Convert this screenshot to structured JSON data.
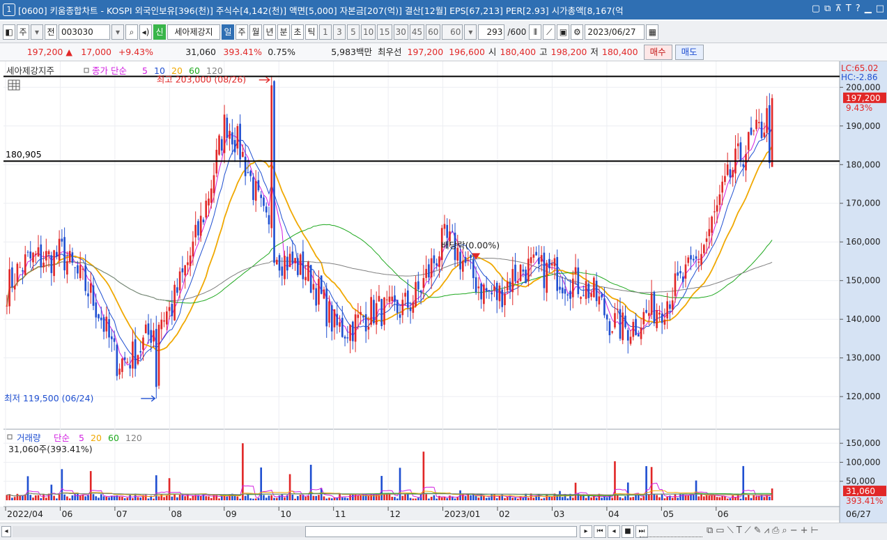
{
  "titlebar": {
    "index": "1",
    "title": "[0600] 키움종합차트 - KOSPI 외국인보유[396(천)] 주식수[4,142(천)] 액면[5,000] 자본금[207(억)] 결산[12월] EPS[67,213] PER[2.93] 시가총액[8,167(억"
  },
  "toolbar": {
    "period": "주",
    "jeon": "전",
    "code": "003030",
    "sin": "신",
    "stock_name": "세아제강지",
    "intervals": [
      "일",
      "주",
      "월",
      "년",
      "분",
      "초",
      "틱"
    ],
    "minutes": [
      "1",
      "3",
      "5",
      "10",
      "15",
      "30",
      "45",
      "60"
    ],
    "count_combo": "60",
    "count": "293",
    "count_max": "/600",
    "date": "2023/06/27"
  },
  "infobar": {
    "price": "197,200",
    "change": "17,000",
    "change_pct": "+9.43%",
    "volume": "31,060",
    "volume_pct": "393.41%",
    "turnover": "0.75%",
    "amount": "5,983백만",
    "best_label": "최우선",
    "best_ask": "197,200",
    "best_bid": "196,600",
    "open_label": "시",
    "open": "180,400",
    "high_label": "고",
    "high": "198,200",
    "low_label": "저",
    "low": "180,400",
    "buy_btn": "매수",
    "sell_btn": "매도"
  },
  "price_pane": {
    "stock_overlay": "세아제강지주",
    "legend_prefix": "종가 단순",
    "legend_ma": [
      "5",
      "10",
      "20",
      "60",
      "120"
    ],
    "legend_ma_colors": [
      "#d11ee0",
      "#1f4fd1",
      "#f0a800",
      "#1ea81e",
      "#808080"
    ],
    "high_label": "최고 203,000 (08/26)",
    "low_label": "최저 119,500 (06/24)",
    "hline_label": "180,905",
    "event_label": "배당락(0.00%)",
    "lc_label": "LC:65.02",
    "hc_label": "HC:-2.86",
    "current_price": "197,200",
    "current_pct": "9.43%"
  },
  "volume_pane": {
    "legend_name": "거래량",
    "legend_prefix": "단순",
    "legend_ma": [
      "5",
      "20",
      "60",
      "120"
    ],
    "legend_ma_colors": [
      "#d11ee0",
      "#f0a800",
      "#1ea81e",
      "#808080"
    ],
    "info_text": "31,060주(393.41%)",
    "current_volume": "31,060",
    "current_pct": "393.41%"
  },
  "x_axis": {
    "labels": [
      "2022/04",
      "06",
      "07",
      "08",
      "09",
      "10",
      "11",
      "12",
      "2023/01",
      "02",
      "03",
      "04",
      "05",
      "06"
    ],
    "current_date": "06/27"
  },
  "colors": {
    "up": "#e12727",
    "down": "#1f4fd1",
    "title_bg": "#2f6fb3",
    "axis_bg": "#d6e3f4",
    "hline": "#000000"
  },
  "chart_data": {
    "type": "candlestick",
    "price_axis_ticks": [
      200000,
      190000,
      180000,
      170000,
      160000,
      150000,
      140000,
      130000,
      120000
    ],
    "price_ylim": [
      113000,
      206000
    ],
    "volume_axis_ticks": [
      150000,
      100000,
      50000
    ],
    "volume_ylim": [
      0,
      165000
    ],
    "hline_value": 180905,
    "period_high": 203000,
    "period_low": 119500,
    "last_close": 197200,
    "last_volume": 31060,
    "monthly_closes": [
      {
        "month": "2022/04",
        "close": 148000
      },
      {
        "month": "2022/05",
        "close": 160000
      },
      {
        "month": "2022/06",
        "close": 130000
      },
      {
        "month": "2022/07",
        "close": 140000
      },
      {
        "month": "2022/08",
        "close": 190000
      },
      {
        "month": "2022/09",
        "close": 158000
      },
      {
        "month": "2022/10",
        "close": 140000
      },
      {
        "month": "2022/11",
        "close": 140000
      },
      {
        "month": "2022/12",
        "close": 158000
      },
      {
        "month": "2023/01",
        "close": 147000
      },
      {
        "month": "2023/02",
        "close": 155000
      },
      {
        "month": "2023/03",
        "close": 140000
      },
      {
        "month": "2023/04",
        "close": 141000
      },
      {
        "month": "2023/05",
        "close": 168000
      },
      {
        "month": "2023/06",
        "close": 197200
      }
    ]
  }
}
